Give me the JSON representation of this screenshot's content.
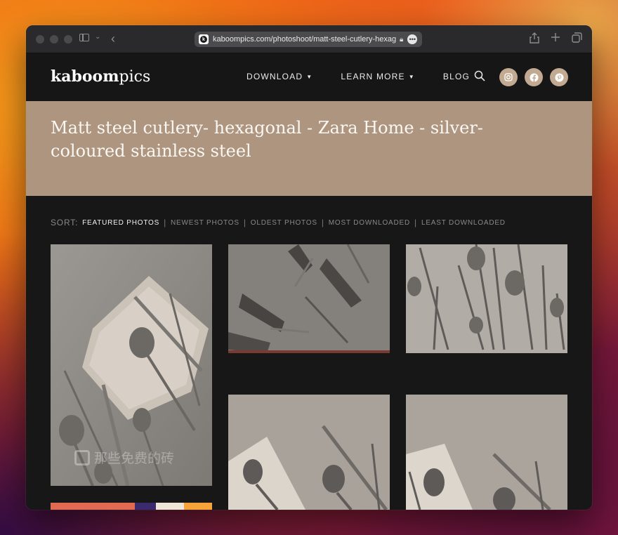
{
  "browser": {
    "url": "kaboompics.com/photoshoot/matt-steel-cutlery-hexag",
    "favicon_letter": "k"
  },
  "site": {
    "logo_bold": "kaboom",
    "logo_light": "pics",
    "nav": [
      {
        "label": "DOWNLOAD",
        "has_caret": true
      },
      {
        "label": "LEARN MORE",
        "has_caret": true
      },
      {
        "label": "BLOG",
        "has_caret": false
      }
    ],
    "social_icons": [
      "instagram-icon",
      "facebook-icon",
      "pinterest-icon"
    ],
    "accent_color": "#c2a991"
  },
  "hero": {
    "title": "Matt steel cutlery- hexagonal - Zara Home - silver-coloured stainless steel",
    "background": "#ad9580"
  },
  "sort": {
    "label": "SORT:",
    "options": [
      {
        "label": "FEATURED PHOTOS",
        "active": true
      },
      {
        "label": "NEWEST PHOTOS",
        "active": false
      },
      {
        "label": "OLDEST PHOTOS",
        "active": false
      },
      {
        "label": "MOST DOWNLOADED",
        "active": false
      },
      {
        "label": "LEAST DOWNLOADED",
        "active": false
      }
    ]
  },
  "gallery": {
    "watermark": "那些免费的砖"
  }
}
